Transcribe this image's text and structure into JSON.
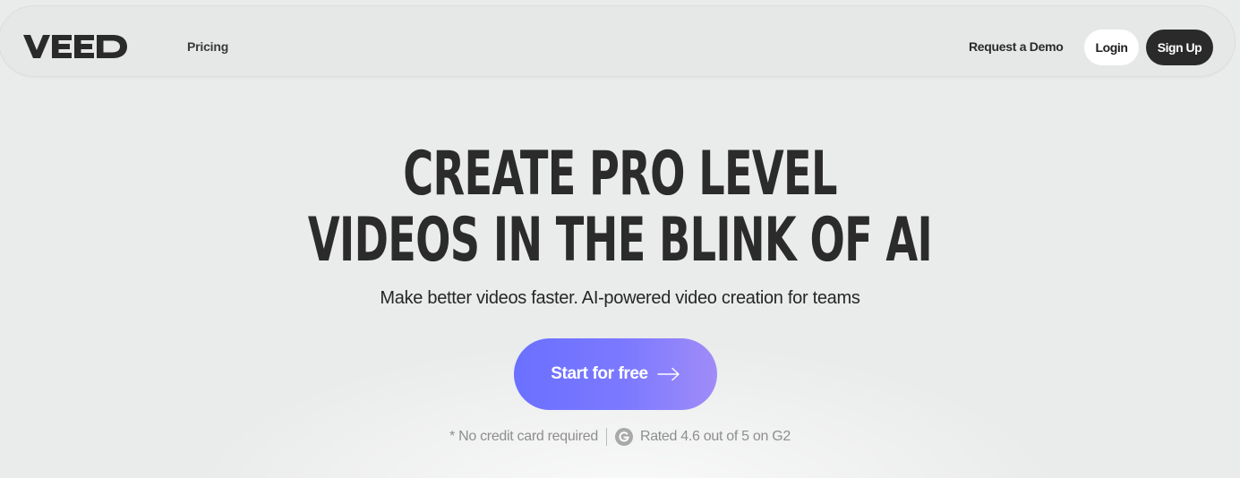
{
  "nav": {
    "logo_text": "VEED",
    "pricing_label": "Pricing",
    "demo_label": "Request a Demo",
    "login_label": "Login",
    "signup_label": "Sign Up"
  },
  "hero": {
    "title_line1": "CREATE PRO LEVEL",
    "title_line2": "VIDEOS IN THE BLINK OF AI",
    "subtitle": "Make better videos faster. AI-powered video creation for teams",
    "cta_label": "Start for free",
    "cta_icon": "arrow-right-icon",
    "note_left": "* No credit card required",
    "rating_text": "Rated 4.6 out of 5 on G2",
    "rating_icon": "g2-icon"
  },
  "colors": {
    "background": "#eaebeb",
    "cta_gradient_start": "#6a70ff",
    "cta_gradient_end": "#a08cf8",
    "signup_bg": "#2a2a2a",
    "login_bg": "#ffffff"
  }
}
